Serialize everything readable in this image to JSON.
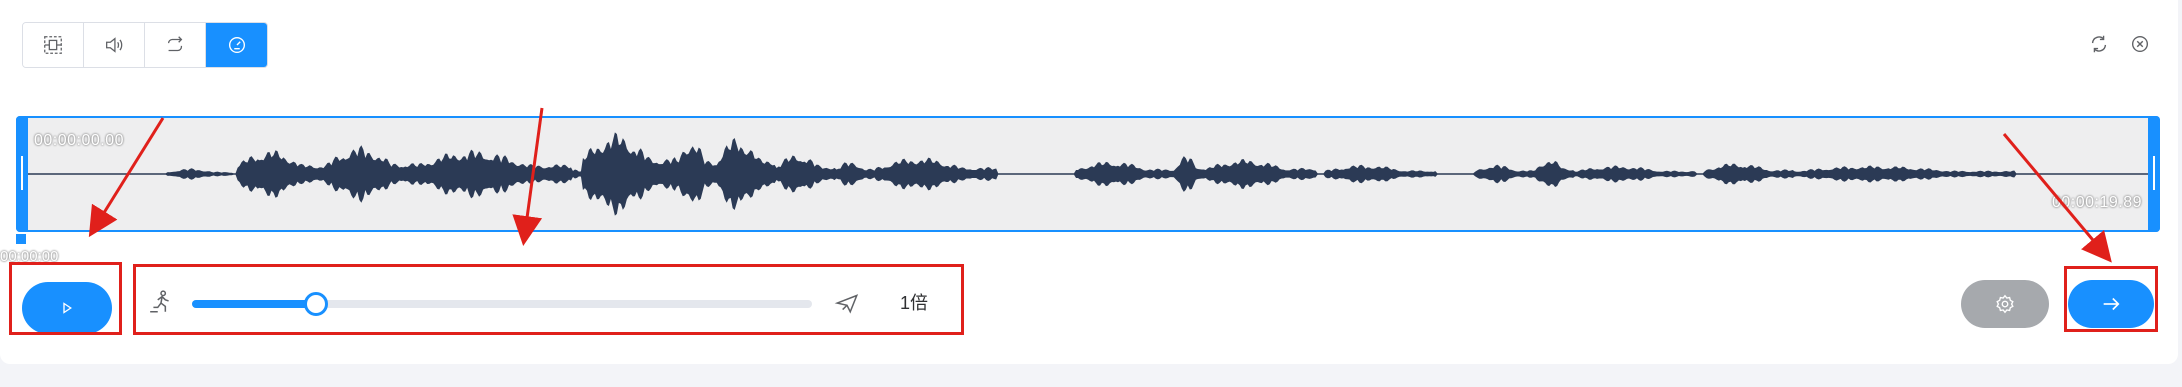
{
  "toolbar": {
    "buttons": [
      {
        "icon": "crop-select-icon",
        "active": false
      },
      {
        "icon": "volume-icon",
        "active": false
      },
      {
        "icon": "loop-icon",
        "active": false
      },
      {
        "icon": "speed-gauge-icon",
        "active": true
      }
    ],
    "right_icons": [
      "refresh-icon",
      "close-circle-icon"
    ]
  },
  "waveform": {
    "start_time": "00:00:00.00",
    "end_time": "00:00:19.89",
    "cursor_time": "00:00:00"
  },
  "playback": {
    "play_icon": "play-icon",
    "speed": {
      "min_icon": "runner-icon",
      "max_icon": "airplane-icon",
      "value": 0.2,
      "label": "1倍"
    }
  },
  "actions": {
    "settings_icon": "gear-icon",
    "next_icon": "arrow-right-icon"
  },
  "colors": {
    "accent": "#1890ff",
    "wave": "#2b3a55",
    "annotation": "#e0201b",
    "settings_bg": "#a6a9ad"
  }
}
